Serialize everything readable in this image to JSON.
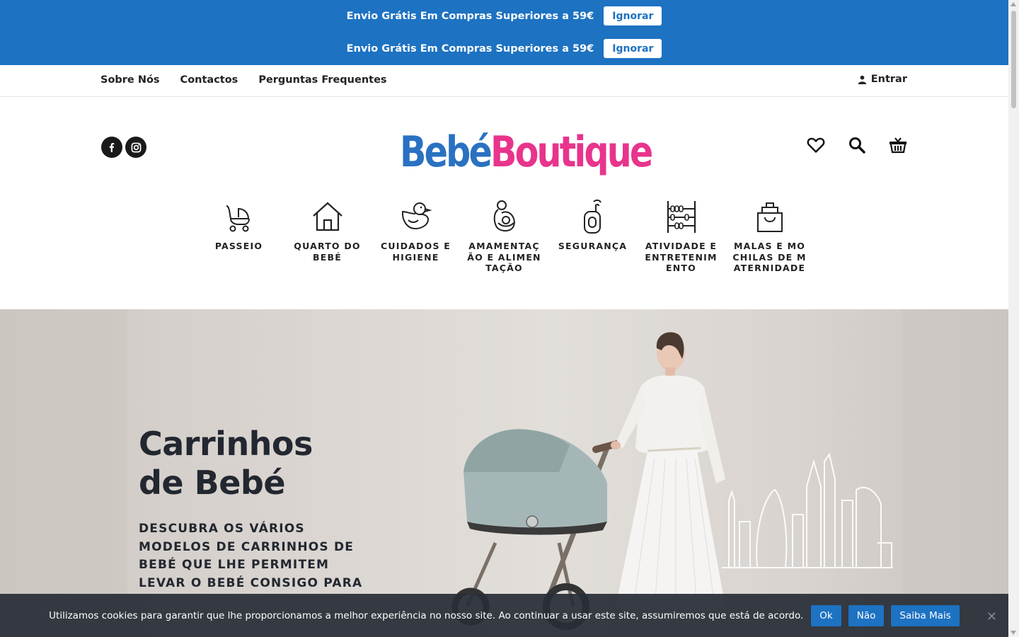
{
  "notice": {
    "rows": [
      {
        "text": "Envio Grátis Em Compras Superiores a 59€",
        "button": "Ignorar"
      },
      {
        "text": "Envio Grátis Em Compras Superiores a 59€",
        "button": "Ignorar"
      }
    ]
  },
  "subnav": {
    "links": [
      "Sobre Nós",
      "Contactos",
      "Perguntas Frequentes"
    ],
    "login_label": "Entrar"
  },
  "header": {
    "socials": [
      "facebook-icon",
      "instagram-icon"
    ],
    "logo": {
      "part1": "Bebé",
      "part2": "Boutique"
    },
    "icons": [
      "heart-icon",
      "search-icon",
      "basket-icon"
    ]
  },
  "categories": [
    {
      "label": "PASSEIO",
      "icon": "stroller-icon"
    },
    {
      "label": "QUARTO DO BEBÉ",
      "icon": "house-icon"
    },
    {
      "label": "CUIDADOS E HIGIENE",
      "icon": "duck-icon"
    },
    {
      "label": "AMAMENTAÇÃO E ALIMENTAÇÃO",
      "icon": "breastfeeding-icon"
    },
    {
      "label": "SEGURANÇA",
      "icon": "baby-monitor-icon"
    },
    {
      "label": "ATIVIDADE E ENTRETENIMENTO",
      "icon": "abacus-icon"
    },
    {
      "label": "MALAS E MOCHILAS DE MATERNIDADE",
      "icon": "bag-icon"
    }
  ],
  "hero": {
    "title_line1": "Carrinhos",
    "title_line2": "de Bebé",
    "subtitle": "DESCUBRA OS VÁRIOS MODELOS DE CARRINHOS DE BEBÉ QUE LHE PERMITEM LEVAR O BEBÉ CONSIGO PARA"
  },
  "cookie": {
    "text": "Utilizamos cookies para garantir que lhe proporcionamos a melhor experiência no nosso site. Ao continuar a usar este site, assumiremos que está de acordo.",
    "ok": "Ok",
    "no": "Não",
    "more": "Saiba Mais"
  },
  "colors": {
    "brand_blue": "#1d72c2",
    "logo_blue": "#2a71c2",
    "logo_pink": "#e8348c"
  }
}
